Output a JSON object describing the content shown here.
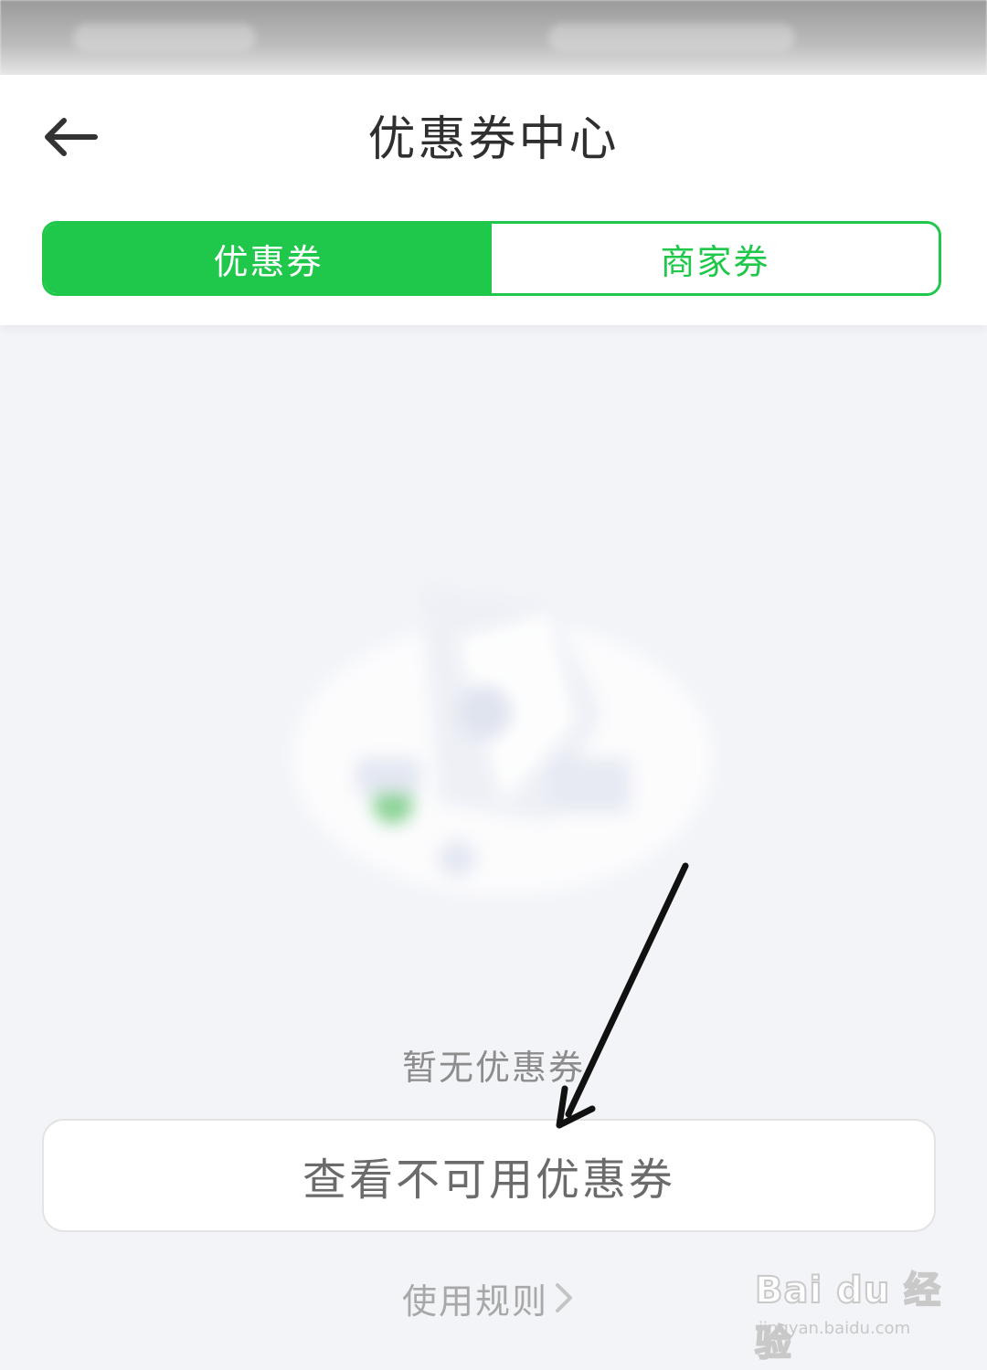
{
  "header": {
    "title": "优惠券中心",
    "back_icon": "arrow-left-icon"
  },
  "tabs": [
    {
      "label": "优惠券",
      "active": true
    },
    {
      "label": "商家券",
      "active": false
    }
  ],
  "empty_state": {
    "message": "暂无优惠券",
    "illustration": "empty-coupon-illustration"
  },
  "actions": {
    "view_unavailable": "查看不可用优惠券",
    "rules": "使用规则",
    "rules_icon": "chevron-right-icon"
  },
  "watermark": {
    "logo": "Bai du 经验",
    "url": "jingyan.baidu.com"
  },
  "colors": {
    "accent": "#1fc74a",
    "background": "#f3f4f8",
    "title": "#2f2f2f",
    "muted": "#8c8c8c"
  }
}
